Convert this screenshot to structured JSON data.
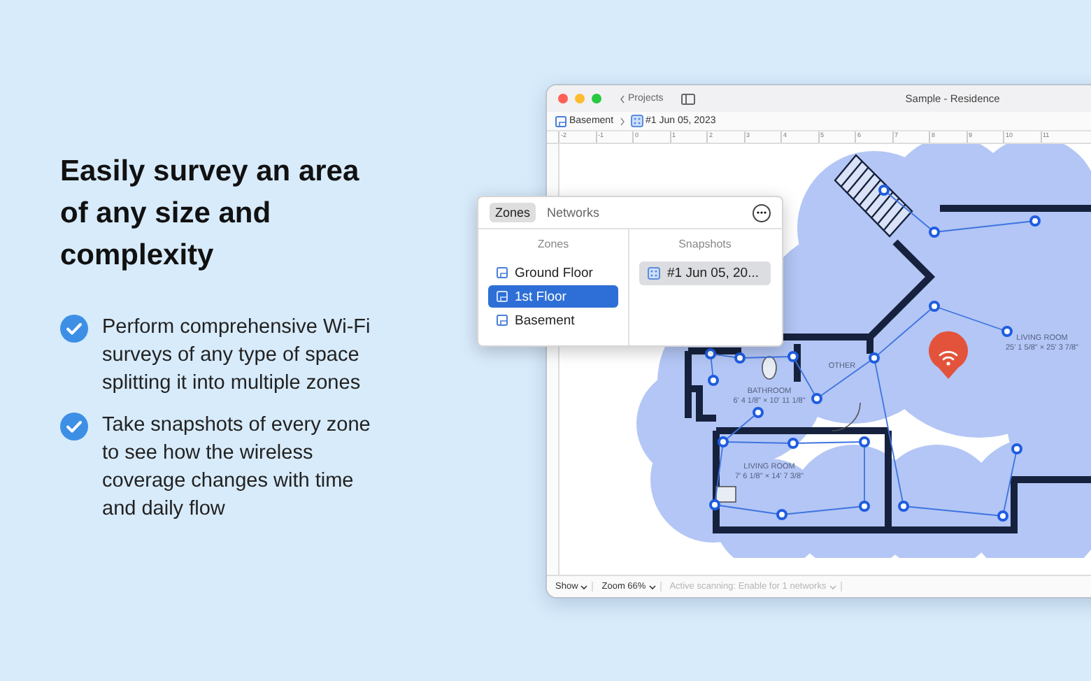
{
  "headline": "Easily survey an area of any size and complexity",
  "features": [
    {
      "text": "Perform comprehensive Wi-Fi surveys of any type of space splitting it into multiple zones"
    },
    {
      "text": "Take snapshots of every zone to see how the wireless coverage changes with time and daily flow"
    }
  ],
  "window": {
    "back": "Projects",
    "title": "Sample - Residence",
    "breadcrumb": [
      "Basement",
      "#1 Jun 05, 2023"
    ],
    "ruler": [
      "-2",
      "-1",
      "0",
      "1",
      "2",
      "3",
      "4",
      "5",
      "6",
      "7",
      "8",
      "9",
      "10",
      "11"
    ],
    "rooms": [
      {
        "name": "LIVING ROOM",
        "size": "25' 1 5/8\" × 25' 3 7/8\""
      },
      {
        "name": "BATHROOM",
        "size": "6' 4 1/8\" × 10' 11 1/8\""
      },
      {
        "name": "OTHER"
      },
      {
        "name": "LIVING ROOM",
        "size": "7' 6 1/8\" × 14' 7 3/8\""
      }
    ],
    "status_bar": [
      {
        "label": "Show",
        "disabled": false
      },
      {
        "label": "Zoom 66%",
        "disabled": false
      },
      {
        "label": "Active scanning: Enable for 1 networks",
        "disabled": true
      }
    ]
  },
  "popover": {
    "tabs": [
      {
        "label": "Zones",
        "selected": true
      },
      {
        "label": "Networks",
        "selected": false
      }
    ],
    "zones_header": "Zones",
    "zones": [
      {
        "label": "Ground Floor",
        "selected": false
      },
      {
        "label": "1st Floor",
        "selected": true
      },
      {
        "label": "Basement",
        "selected": false
      }
    ],
    "snapshots_header": "Snapshots",
    "snapshots": [
      {
        "label": "#1 Jun 05, 20...",
        "selected": true
      }
    ]
  }
}
